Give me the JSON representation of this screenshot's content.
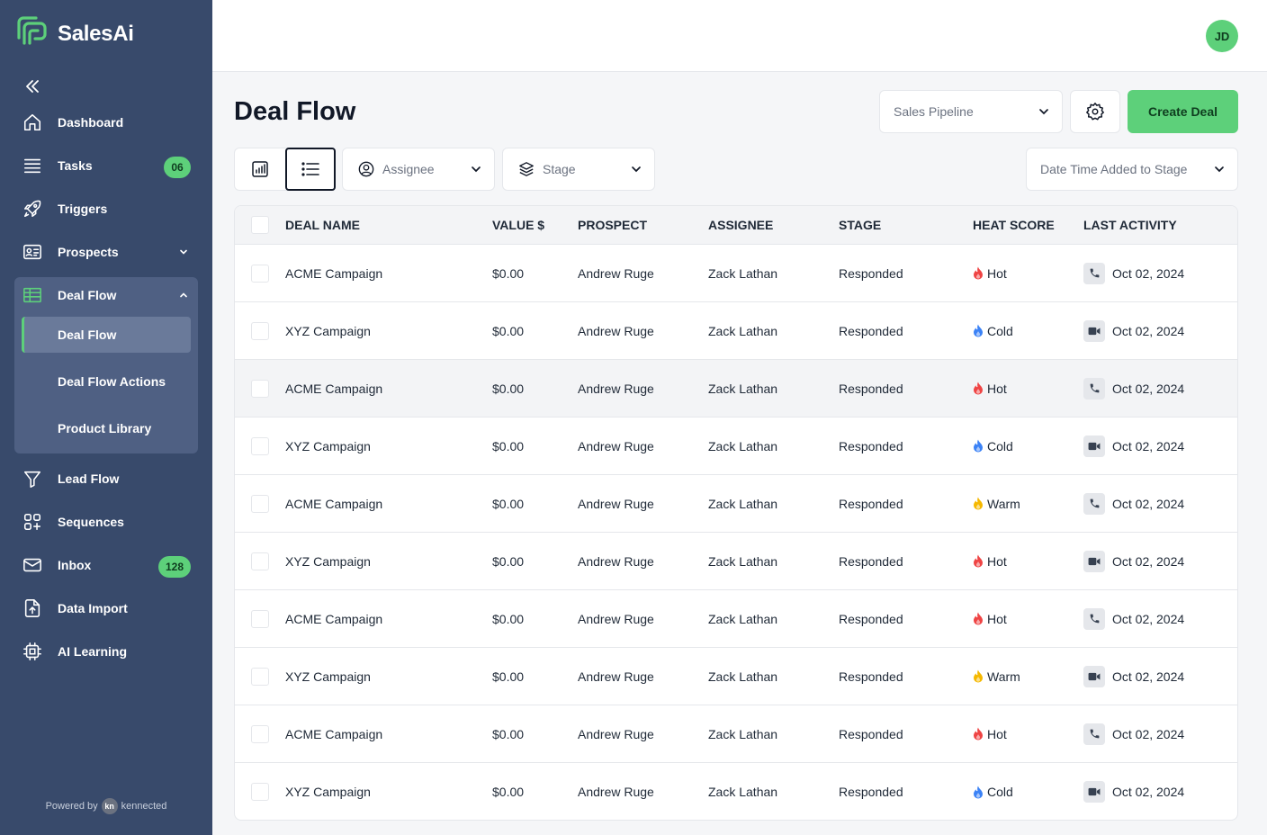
{
  "app": {
    "name": "SalesAi"
  },
  "colors": {
    "sidebar": "#384a6b",
    "accent": "#5dd07a",
    "hot": "#ef4444",
    "cold": "#3b82f6",
    "warm": "#f5b800"
  },
  "sidebar": {
    "items": [
      {
        "label": "Dashboard",
        "icon": "home-icon"
      },
      {
        "label": "Tasks",
        "icon": "list-icon",
        "badge": "06"
      },
      {
        "label": "Triggers",
        "icon": "rocket-icon"
      },
      {
        "label": "Prospects",
        "icon": "contact-card-icon"
      },
      {
        "label": "Deal Flow",
        "icon": "table-icon"
      },
      {
        "label": "Lead Flow",
        "icon": "funnel-icon"
      },
      {
        "label": "Sequences",
        "icon": "sequences-icon"
      },
      {
        "label": "Inbox",
        "icon": "mail-icon",
        "badge": "128"
      },
      {
        "label": "Data Import",
        "icon": "file-upload-icon"
      },
      {
        "label": "AI Learning",
        "icon": "chip-icon"
      }
    ],
    "deal_flow_sub": [
      "Deal Flow",
      "Deal Flow Actions",
      "Product Library"
    ],
    "powered_by": "Powered by",
    "powered_brand": "kennected",
    "powered_logo": "kn"
  },
  "header": {
    "avatar": "JD"
  },
  "page": {
    "title": "Deal Flow",
    "pipeline_select": "Sales Pipeline",
    "create_button": "Create Deal",
    "filters": {
      "assignee": "Assignee",
      "stage": "Stage",
      "date": "Date Time Added to Stage"
    }
  },
  "table": {
    "columns": [
      "DEAL NAME",
      "VALUE $",
      "PROSPECT",
      "ASSIGNEE",
      "STAGE",
      "HEAT SCORE",
      "LAST ACTIVITY"
    ],
    "rows": [
      {
        "deal": "ACME Campaign",
        "value": "$0.00",
        "prospect": "Andrew Ruge",
        "assignee": "Zack Lathan",
        "stage": "Responded",
        "heat": "Hot",
        "activity_type": "phone",
        "date": "Oct 02, 2024"
      },
      {
        "deal": "XYZ Campaign",
        "value": "$0.00",
        "prospect": "Andrew Ruge",
        "assignee": "Zack Lathan",
        "stage": "Responded",
        "heat": "Cold",
        "activity_type": "video",
        "date": "Oct 02, 2024"
      },
      {
        "deal": "ACME Campaign",
        "value": "$0.00",
        "prospect": "Andrew Ruge",
        "assignee": "Zack Lathan",
        "stage": "Responded",
        "heat": "Hot",
        "activity_type": "phone",
        "date": "Oct 02, 2024"
      },
      {
        "deal": "XYZ Campaign",
        "value": "$0.00",
        "prospect": "Andrew Ruge",
        "assignee": "Zack Lathan",
        "stage": "Responded",
        "heat": "Cold",
        "activity_type": "video",
        "date": "Oct 02, 2024"
      },
      {
        "deal": "ACME Campaign",
        "value": "$0.00",
        "prospect": "Andrew Ruge",
        "assignee": "Zack Lathan",
        "stage": "Responded",
        "heat": "Warm",
        "activity_type": "phone",
        "date": "Oct 02, 2024"
      },
      {
        "deal": "XYZ Campaign",
        "value": "$0.00",
        "prospect": "Andrew Ruge",
        "assignee": "Zack Lathan",
        "stage": "Responded",
        "heat": "Hot",
        "activity_type": "video",
        "date": "Oct 02, 2024"
      },
      {
        "deal": "ACME Campaign",
        "value": "$0.00",
        "prospect": "Andrew Ruge",
        "assignee": "Zack Lathan",
        "stage": "Responded",
        "heat": "Hot",
        "activity_type": "phone",
        "date": "Oct 02, 2024"
      },
      {
        "deal": "XYZ Campaign",
        "value": "$0.00",
        "prospect": "Andrew Ruge",
        "assignee": "Zack Lathan",
        "stage": "Responded",
        "heat": "Warm",
        "activity_type": "video",
        "date": "Oct 02, 2024"
      },
      {
        "deal": "ACME Campaign",
        "value": "$0.00",
        "prospect": "Andrew Ruge",
        "assignee": "Zack Lathan",
        "stage": "Responded",
        "heat": "Hot",
        "activity_type": "phone",
        "date": "Oct 02, 2024"
      },
      {
        "deal": "XYZ Campaign",
        "value": "$0.00",
        "prospect": "Andrew Ruge",
        "assignee": "Zack Lathan",
        "stage": "Responded",
        "heat": "Cold",
        "activity_type": "video",
        "date": "Oct 02, 2024"
      }
    ]
  }
}
